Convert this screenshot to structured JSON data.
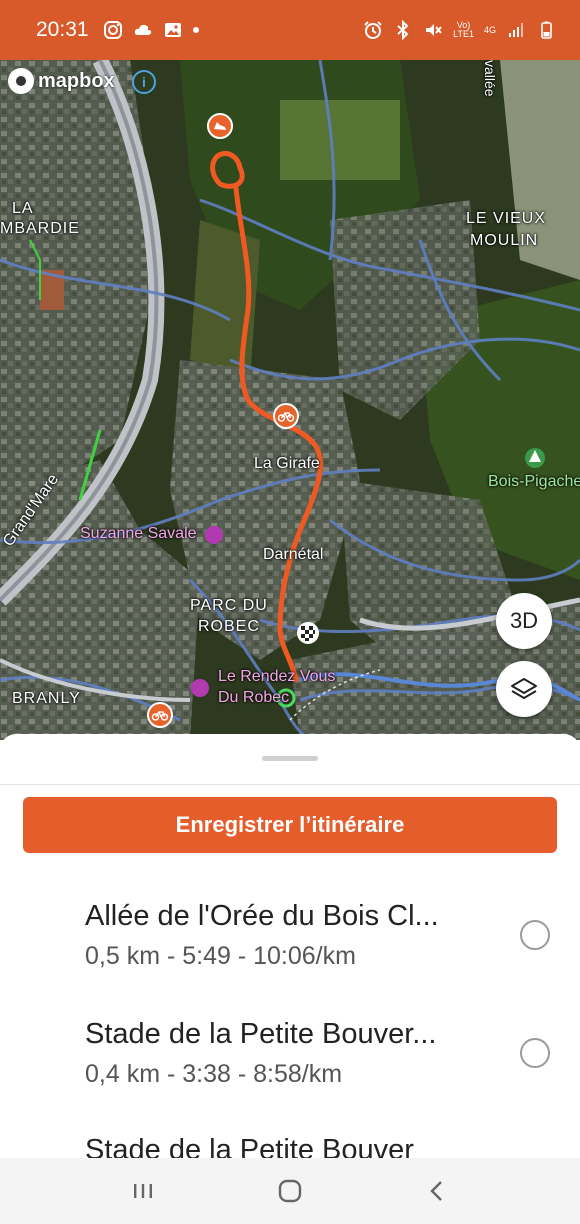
{
  "status_bar": {
    "time": "20:31",
    "left_icons": [
      "instagram-icon",
      "cloud-icon",
      "gallery-icon"
    ],
    "right_icons": [
      "alarm-icon",
      "bluetooth-icon",
      "mute-icon",
      "volte-icon",
      "4g-icon",
      "signal-icon",
      "battery-icon"
    ],
    "volte_text": "VoLTE1",
    "network_text": "4G",
    "bar_color": "#d85a2a"
  },
  "map": {
    "attribution": "mapbox",
    "labels": {
      "la_mbardie_1": "LA",
      "la_mbardie_2": "MBARDIE",
      "vieux_1": "LE VIEUX",
      "vieux_2": "MOULIN",
      "la_girafe": "La Girafe",
      "bois": "Bois-Pigache",
      "suzanne": "Suzanne Savale",
      "darnetal": "Darnétal",
      "parc_1": "PARC DU",
      "parc_2": "ROBEC",
      "grand_mare": "Grand'Mare",
      "branly": "BRANLY",
      "rdv_1": "Le Rendez Vous",
      "rdv_2": "Du Robec",
      "vallee": "vallée"
    },
    "btn_3d": "3D",
    "route_color": "#f05a22"
  },
  "sheet": {
    "save_label": "Enregistrer l’itinéraire",
    "routes": [
      {
        "title": "Allée de l'Orée du Bois Cl...",
        "sub": "0,5 km - 5:49 - 10:06/km"
      },
      {
        "title": "Stade de la Petite Bouver...",
        "sub": "0,4 km - 3:38 - 8:58/km"
      },
      {
        "title": "Stade de la Petite Bouver",
        "sub": ""
      }
    ]
  },
  "nav_bar": {
    "buttons": [
      "recent-apps-icon",
      "home-icon",
      "back-icon"
    ]
  }
}
